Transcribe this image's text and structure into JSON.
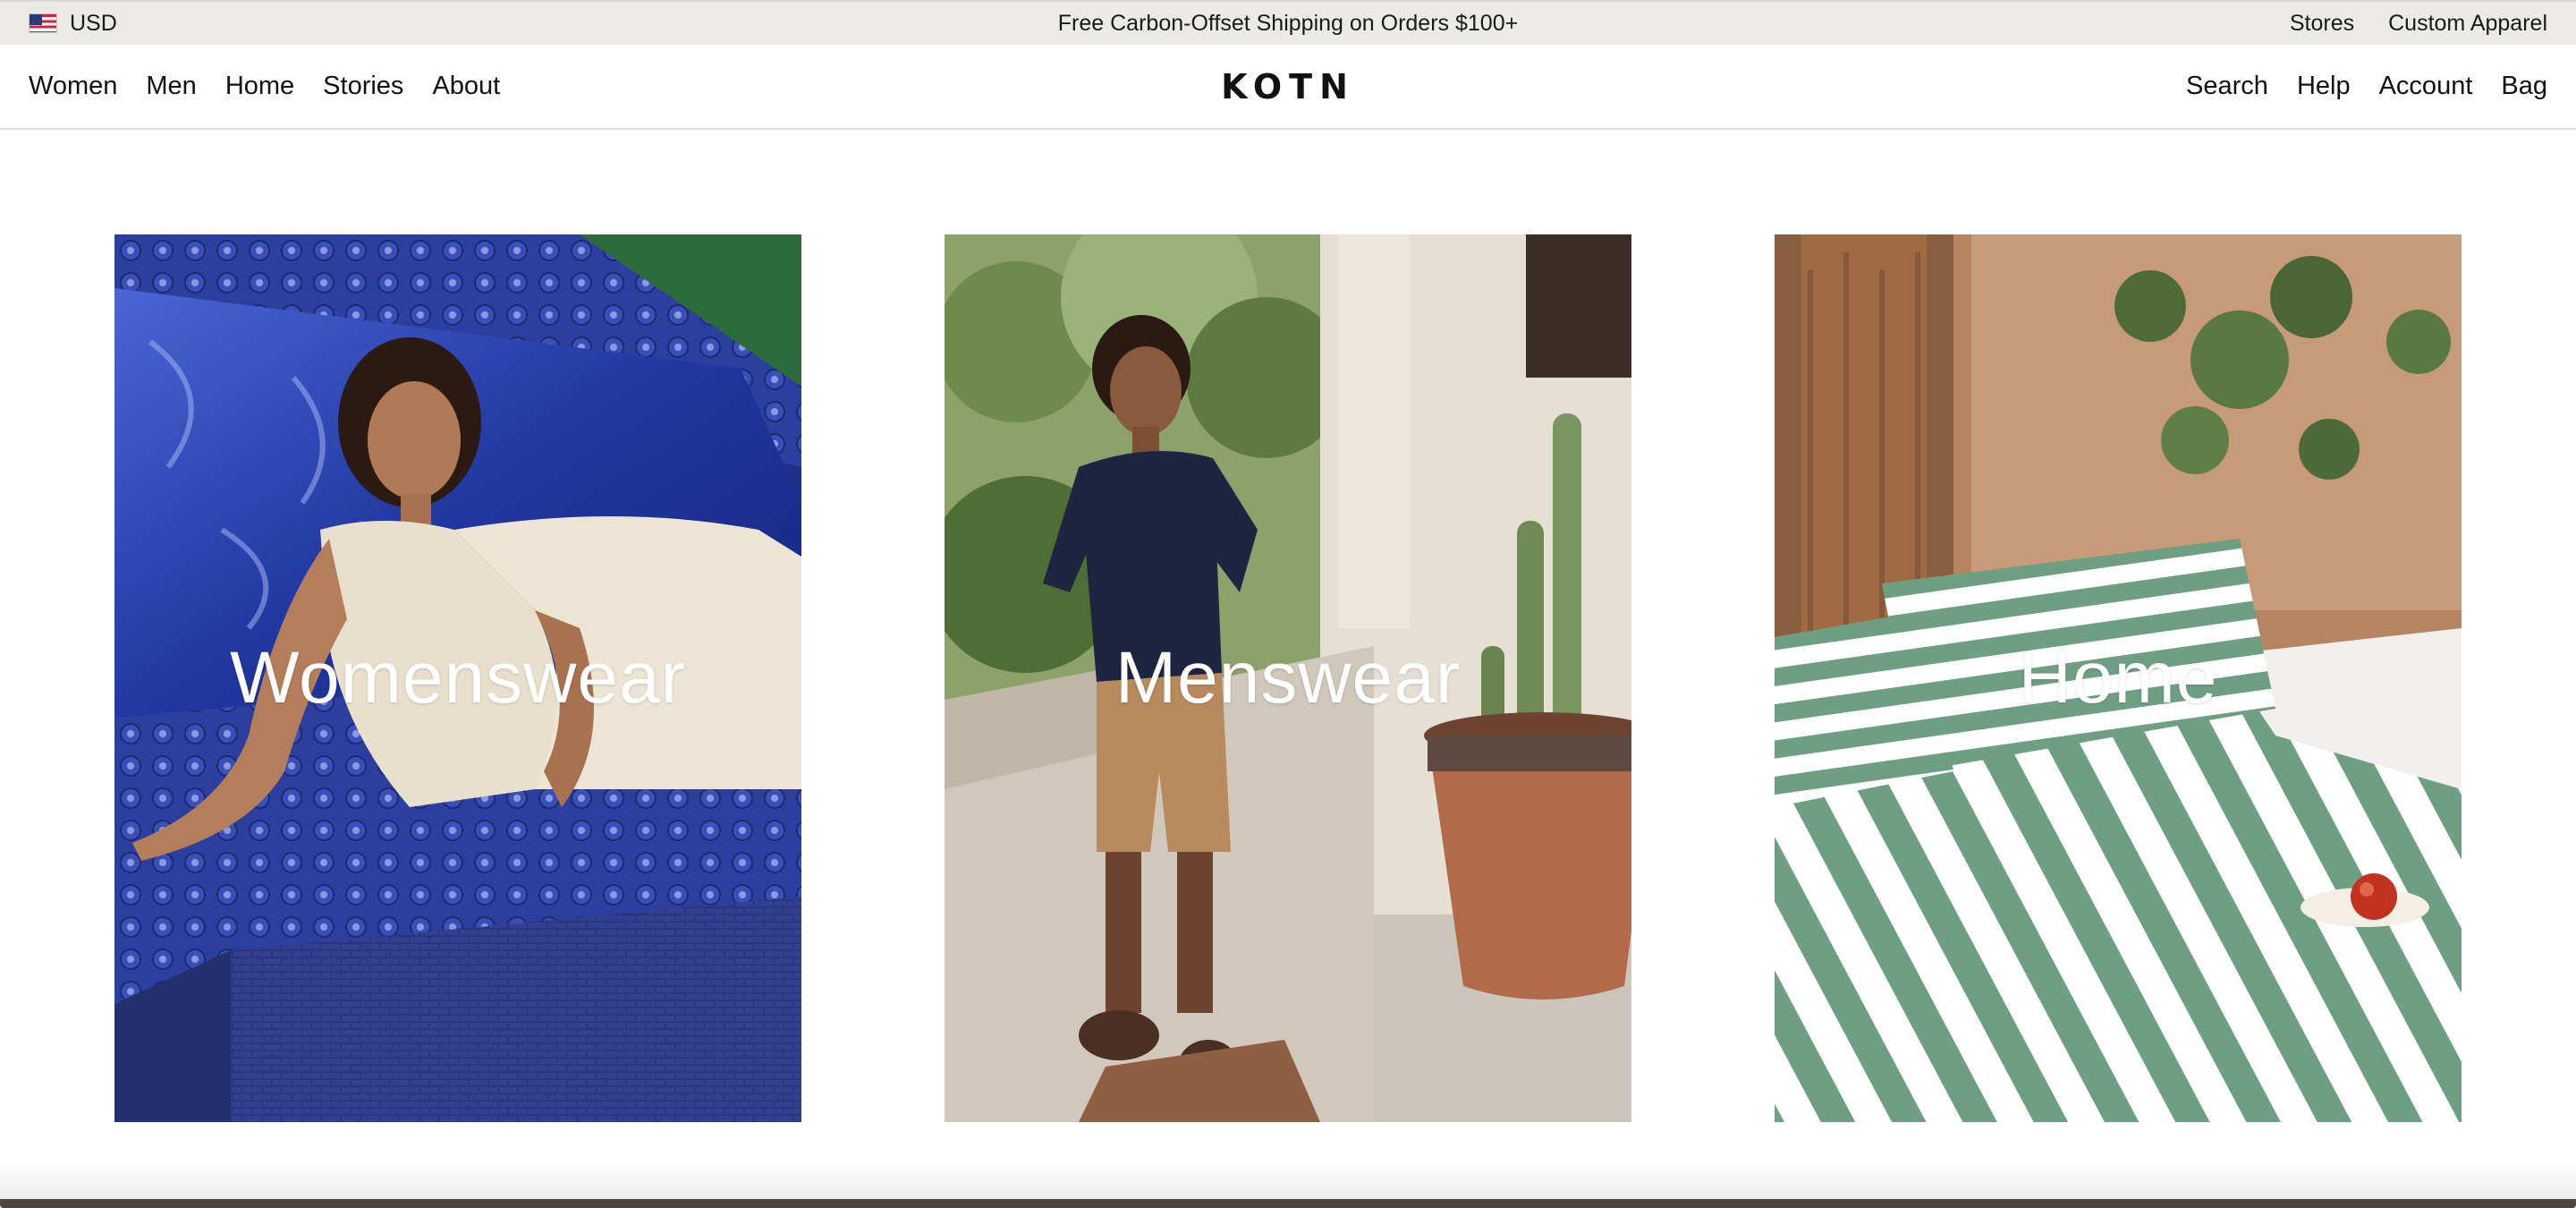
{
  "announcement": {
    "currency": "USD",
    "message": "Free Carbon-Offset Shipping on Orders $100+",
    "links": [
      "Stores",
      "Custom Apparel"
    ]
  },
  "nav": {
    "left": [
      "Women",
      "Men",
      "Home",
      "Stories",
      "About"
    ],
    "logo": "KOTN",
    "right": [
      "Search",
      "Help",
      "Account",
      "Bag"
    ]
  },
  "categories": [
    {
      "label": "Womenswear"
    },
    {
      "label": "Menswear"
    },
    {
      "label": "Home"
    }
  ],
  "colors": {
    "announce_bg": "#ebeae6",
    "pool_blue": "#2c3f9a",
    "stripe_green": "#6f9f82"
  }
}
